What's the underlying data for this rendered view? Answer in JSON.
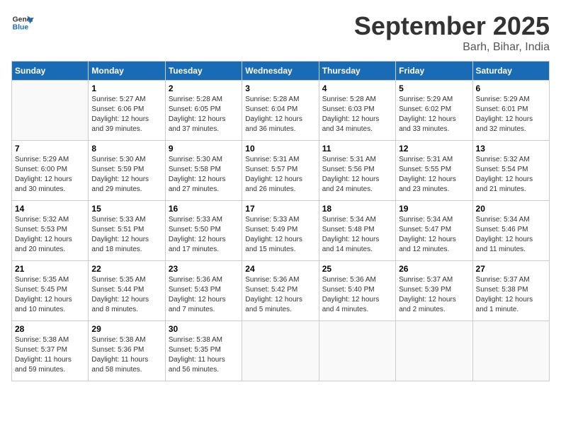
{
  "header": {
    "logo_line1": "General",
    "logo_line2": "Blue",
    "month": "September 2025",
    "location": "Barh, Bihar, India"
  },
  "days_of_week": [
    "Sunday",
    "Monday",
    "Tuesday",
    "Wednesday",
    "Thursday",
    "Friday",
    "Saturday"
  ],
  "weeks": [
    [
      {
        "day": "",
        "info": ""
      },
      {
        "day": "1",
        "info": "Sunrise: 5:27 AM\nSunset: 6:06 PM\nDaylight: 12 hours\nand 39 minutes."
      },
      {
        "day": "2",
        "info": "Sunrise: 5:28 AM\nSunset: 6:05 PM\nDaylight: 12 hours\nand 37 minutes."
      },
      {
        "day": "3",
        "info": "Sunrise: 5:28 AM\nSunset: 6:04 PM\nDaylight: 12 hours\nand 36 minutes."
      },
      {
        "day": "4",
        "info": "Sunrise: 5:28 AM\nSunset: 6:03 PM\nDaylight: 12 hours\nand 34 minutes."
      },
      {
        "day": "5",
        "info": "Sunrise: 5:29 AM\nSunset: 6:02 PM\nDaylight: 12 hours\nand 33 minutes."
      },
      {
        "day": "6",
        "info": "Sunrise: 5:29 AM\nSunset: 6:01 PM\nDaylight: 12 hours\nand 32 minutes."
      }
    ],
    [
      {
        "day": "7",
        "info": "Sunrise: 5:29 AM\nSunset: 6:00 PM\nDaylight: 12 hours\nand 30 minutes."
      },
      {
        "day": "8",
        "info": "Sunrise: 5:30 AM\nSunset: 5:59 PM\nDaylight: 12 hours\nand 29 minutes."
      },
      {
        "day": "9",
        "info": "Sunrise: 5:30 AM\nSunset: 5:58 PM\nDaylight: 12 hours\nand 27 minutes."
      },
      {
        "day": "10",
        "info": "Sunrise: 5:31 AM\nSunset: 5:57 PM\nDaylight: 12 hours\nand 26 minutes."
      },
      {
        "day": "11",
        "info": "Sunrise: 5:31 AM\nSunset: 5:56 PM\nDaylight: 12 hours\nand 24 minutes."
      },
      {
        "day": "12",
        "info": "Sunrise: 5:31 AM\nSunset: 5:55 PM\nDaylight: 12 hours\nand 23 minutes."
      },
      {
        "day": "13",
        "info": "Sunrise: 5:32 AM\nSunset: 5:54 PM\nDaylight: 12 hours\nand 21 minutes."
      }
    ],
    [
      {
        "day": "14",
        "info": "Sunrise: 5:32 AM\nSunset: 5:53 PM\nDaylight: 12 hours\nand 20 minutes."
      },
      {
        "day": "15",
        "info": "Sunrise: 5:33 AM\nSunset: 5:51 PM\nDaylight: 12 hours\nand 18 minutes."
      },
      {
        "day": "16",
        "info": "Sunrise: 5:33 AM\nSunset: 5:50 PM\nDaylight: 12 hours\nand 17 minutes."
      },
      {
        "day": "17",
        "info": "Sunrise: 5:33 AM\nSunset: 5:49 PM\nDaylight: 12 hours\nand 15 minutes."
      },
      {
        "day": "18",
        "info": "Sunrise: 5:34 AM\nSunset: 5:48 PM\nDaylight: 12 hours\nand 14 minutes."
      },
      {
        "day": "19",
        "info": "Sunrise: 5:34 AM\nSunset: 5:47 PM\nDaylight: 12 hours\nand 12 minutes."
      },
      {
        "day": "20",
        "info": "Sunrise: 5:34 AM\nSunset: 5:46 PM\nDaylight: 12 hours\nand 11 minutes."
      }
    ],
    [
      {
        "day": "21",
        "info": "Sunrise: 5:35 AM\nSunset: 5:45 PM\nDaylight: 12 hours\nand 10 minutes."
      },
      {
        "day": "22",
        "info": "Sunrise: 5:35 AM\nSunset: 5:44 PM\nDaylight: 12 hours\nand 8 minutes."
      },
      {
        "day": "23",
        "info": "Sunrise: 5:36 AM\nSunset: 5:43 PM\nDaylight: 12 hours\nand 7 minutes."
      },
      {
        "day": "24",
        "info": "Sunrise: 5:36 AM\nSunset: 5:42 PM\nDaylight: 12 hours\nand 5 minutes."
      },
      {
        "day": "25",
        "info": "Sunrise: 5:36 AM\nSunset: 5:40 PM\nDaylight: 12 hours\nand 4 minutes."
      },
      {
        "day": "26",
        "info": "Sunrise: 5:37 AM\nSunset: 5:39 PM\nDaylight: 12 hours\nand 2 minutes."
      },
      {
        "day": "27",
        "info": "Sunrise: 5:37 AM\nSunset: 5:38 PM\nDaylight: 12 hours\nand 1 minute."
      }
    ],
    [
      {
        "day": "28",
        "info": "Sunrise: 5:38 AM\nSunset: 5:37 PM\nDaylight: 11 hours\nand 59 minutes."
      },
      {
        "day": "29",
        "info": "Sunrise: 5:38 AM\nSunset: 5:36 PM\nDaylight: 11 hours\nand 58 minutes."
      },
      {
        "day": "30",
        "info": "Sunrise: 5:38 AM\nSunset: 5:35 PM\nDaylight: 11 hours\nand 56 minutes."
      },
      {
        "day": "",
        "info": ""
      },
      {
        "day": "",
        "info": ""
      },
      {
        "day": "",
        "info": ""
      },
      {
        "day": "",
        "info": ""
      }
    ]
  ]
}
